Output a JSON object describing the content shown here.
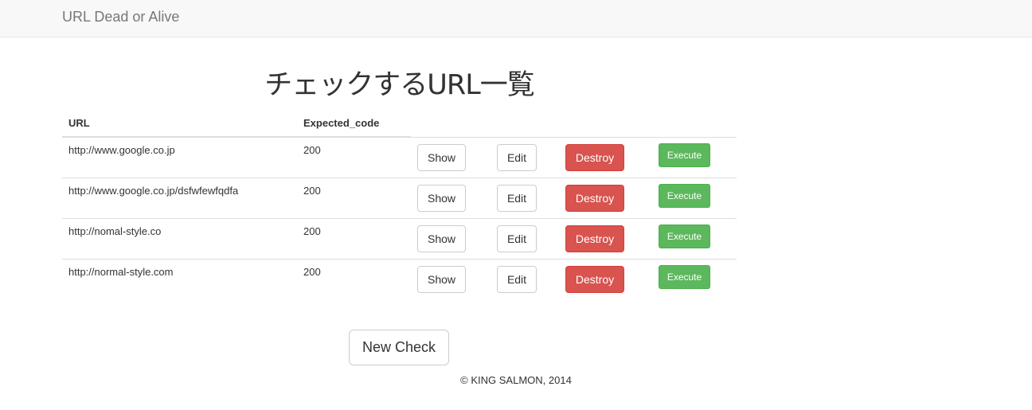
{
  "navbar": {
    "brand": "URL Dead or Alive"
  },
  "page_title": "チェックするURL一覧",
  "table": {
    "headers": {
      "url": "URL",
      "expected_code": "Expected_code"
    },
    "rows": [
      {
        "url": "http://www.google.co.jp",
        "expected_code": "200"
      },
      {
        "url": "http://www.google.co.jp/dsfwfewfqdfa",
        "expected_code": "200"
      },
      {
        "url": "http://nomal-style.co",
        "expected_code": "200"
      },
      {
        "url": "http://normal-style.com",
        "expected_code": "200"
      }
    ],
    "actions": {
      "show": "Show",
      "edit": "Edit",
      "destroy": "Destroy",
      "execute": "Execute"
    }
  },
  "new_check_label": "New Check",
  "footer": "© KING SALMON, 2014",
  "colors": {
    "navbar_bg": "#f8f8f8",
    "danger": "#d9534f",
    "success": "#5cb85c",
    "brand_text": "#777777"
  }
}
